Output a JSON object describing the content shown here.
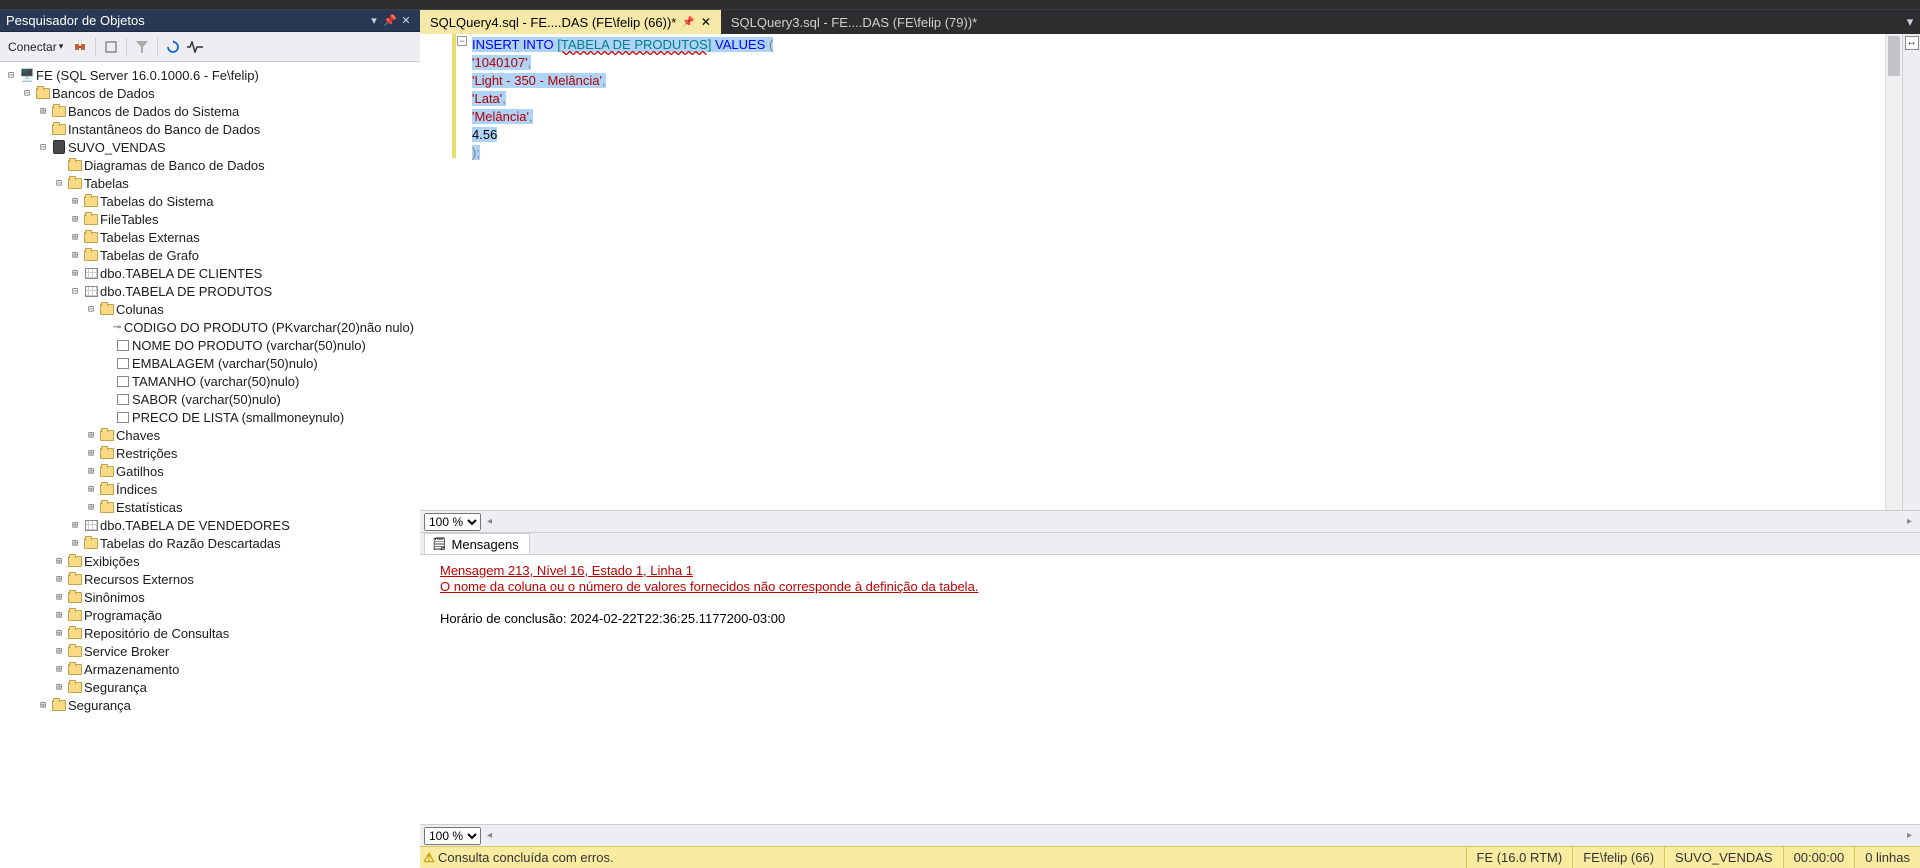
{
  "objectExplorer": {
    "title": "Pesquisador de Objetos",
    "connect_label": "Conectar",
    "server": "FE (SQL Server 16.0.1000.6 - Fe\\felip)",
    "nodes": {
      "databases": "Bancos de Dados",
      "sysdb": "Bancos de Dados do Sistema",
      "snapshots": "Instantâneos do Banco de Dados",
      "suvo": "SUVO_VENDAS",
      "diagrams": "Diagramas de Banco de Dados",
      "tables": "Tabelas",
      "systables": "Tabelas do Sistema",
      "filetables": "FileTables",
      "exttables": "Tabelas Externas",
      "graphtables": "Tabelas de Grafo",
      "t_clientes": "dbo.TABELA DE CLIENTES",
      "t_produtos": "dbo.TABELA DE PRODUTOS",
      "columns": "Colunas",
      "col_codigo": "CODIGO DO PRODUTO (PKvarchar(20)não nulo)",
      "col_nome": "NOME DO PRODUTO (varchar(50)nulo)",
      "col_embalagem": "EMBALAGEM (varchar(50)nulo)",
      "col_tamanho": "TAMANHO (varchar(50)nulo)",
      "col_sabor": "SABOR (varchar(50)nulo)",
      "col_preco": "PRECO DE LISTA (smallmoneynulo)",
      "keys": "Chaves",
      "constraints": "Restrições",
      "triggers": "Gatilhos",
      "indexes": "Índices",
      "stats": "Estatísticas",
      "t_vendedores": "dbo.TABELA DE VENDEDORES",
      "droptables": "Tabelas do Razão Descartadas",
      "views": "Exibições",
      "extres": "Recursos Externos",
      "synonyms": "Sinônimos",
      "programming": "Programação",
      "queryrepo": "Repositório de Consultas",
      "servicebroker": "Service Broker",
      "storage": "Armazenamento",
      "security": "Segurança",
      "security2": "Segurança"
    }
  },
  "tabs": [
    {
      "label": "SQLQuery4.sql - FE....DAS (FE\\felip (66))*",
      "active": true
    },
    {
      "label": "SQLQuery3.sql - FE....DAS (FE\\felip (79))*",
      "active": false
    }
  ],
  "editor": {
    "tokens": {
      "insert_into": "INSERT INTO",
      "table": "[TABELA DE PRODUTOS]",
      "values": "VALUES",
      "paren_open": "(",
      "v1": "'1040107'",
      "v2": "'Light - 350 - Melância'",
      "v3": "'Lata'",
      "v4": "'Melância'",
      "v5": "4.56",
      "close": ");",
      "comma": ","
    }
  },
  "zoom": {
    "options": [
      "100 %"
    ],
    "value": "100 %"
  },
  "messages": {
    "tab": "Mensagens",
    "line1": "Mensagem 213, Nível 16, Estado 1, Linha 1",
    "line2": "O nome da coluna ou o número de valores fornecidos não corresponde à definição da tabela.",
    "line3": "Horário de conclusão: 2024-02-22T22:36:25.1177200-03:00"
  },
  "status": {
    "warn_icon": "⚠",
    "msg": "Consulta concluída com erros.",
    "server": "FE (16.0 RTM)",
    "user": "FE\\felip (66)",
    "db": "SUVO_VENDAS",
    "time": "00:00:00",
    "rows": "0 linhas"
  }
}
